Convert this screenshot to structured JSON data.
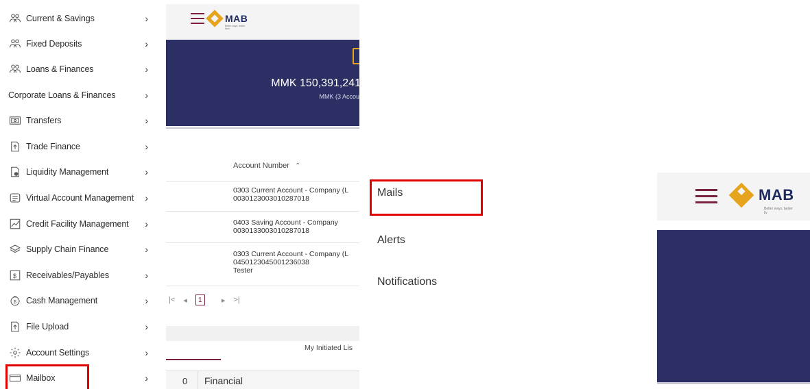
{
  "sidebar": {
    "items": [
      {
        "label": "Current & Savings",
        "icon": "people-icon"
      },
      {
        "label": "Fixed Deposits",
        "icon": "people-icon"
      },
      {
        "label": "Loans & Finances",
        "icon": "people-icon"
      },
      {
        "label": "Corporate Loans & Finances",
        "icon": ""
      },
      {
        "label": "Transfers",
        "icon": "transfer-icon"
      },
      {
        "label": "Trade Finance",
        "icon": "upload-doc-icon"
      },
      {
        "label": "Liquidity Management",
        "icon": "liquidity-icon"
      },
      {
        "label": "Virtual Account Management",
        "icon": "virtual-account-icon"
      },
      {
        "label": "Credit Facility Management",
        "icon": "chart-line-icon"
      },
      {
        "label": "Supply Chain Finance",
        "icon": "layers-icon"
      },
      {
        "label": "Receivables/Payables",
        "icon": "dollar-doc-icon"
      },
      {
        "label": "Cash Management",
        "icon": "money-bag-icon"
      },
      {
        "label": "File Upload",
        "icon": "upload-doc-icon"
      },
      {
        "label": "Account Settings",
        "icon": "gear-icon"
      },
      {
        "label": "Mailbox",
        "icon": "mailbox-icon"
      }
    ],
    "chevron": "›"
  },
  "app": {
    "logo_text": "MAB",
    "logo_tagline": "Better ways, better lives",
    "balance": "MMK 150,391,241",
    "balance_sub": "MMK (3 Accou",
    "table_header": "Account Number",
    "accounts": [
      {
        "name": "0303 Current Account - Company (L",
        "number": "0030123003010287018",
        "extra": ""
      },
      {
        "name": "0403 Saving Account - Company",
        "number": "0030133003010287018",
        "extra": ""
      },
      {
        "name": "0303 Current Account - Company (L",
        "number": "0450123045001236038",
        "extra": "Tester"
      }
    ],
    "pager": {
      "first": "|<",
      "prev": "◂",
      "current": "1",
      "next": "▸",
      "last": ">|"
    },
    "tab_label": "My Initiated Lis",
    "bottom_count": "0",
    "bottom_label": "Financial"
  },
  "mailbox_submenu": {
    "items": [
      "Mails",
      "Alerts",
      "Notifications"
    ]
  },
  "crop": {
    "logo_text": "MAB",
    "logo_tagline": "Better ways, better liv"
  },
  "colors": {
    "highlight": "#e00000",
    "navy": "#2b2f64",
    "maroon": "#7a2040",
    "gold": "#e6a41d"
  }
}
